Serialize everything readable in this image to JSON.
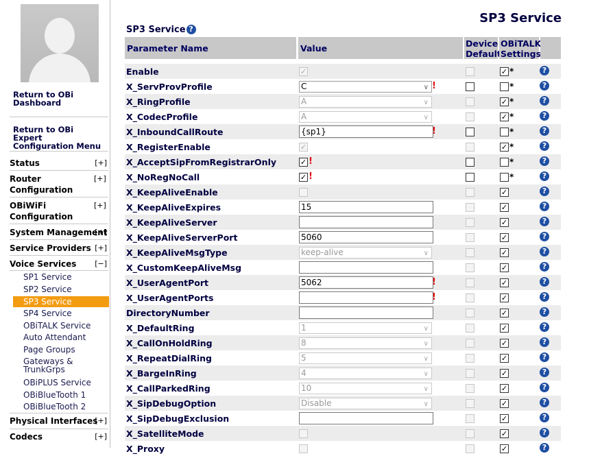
{
  "page": {
    "title": "SP3 Service",
    "section_title": "SP3 Service"
  },
  "sidebar": {
    "links": [
      "Return to OBi Dashboard",
      "Return to OBi Expert Configuration Menu"
    ],
    "menus": [
      {
        "label": "Status",
        "toggle": "[+]"
      },
      {
        "label": "Router Configuration",
        "toggle": "[+]"
      },
      {
        "label": "OBiWiFi Configuration",
        "toggle": "[+]"
      },
      {
        "label": "System Management",
        "toggle": "[+]"
      },
      {
        "label": "Service Providers",
        "toggle": "[+]"
      },
      {
        "label": "Voice Services",
        "toggle": "[−]"
      },
      {
        "label": "Physical Interfaces",
        "toggle": "[+]"
      },
      {
        "label": "Codecs",
        "toggle": "[+]"
      }
    ],
    "voice_items": [
      "SP1 Service",
      "SP2 Service",
      "SP3 Service",
      "SP4 Service",
      "OBiTALK Service",
      "Auto Attendant",
      "Page Groups",
      "Gateways & TrunkGrps",
      "OBiPLUS Service",
      "OBiBlueTooth 1",
      "OBiBlueTooth 2"
    ],
    "selected": "SP3 Service"
  },
  "table": {
    "headers": {
      "name": "Parameter Name",
      "value": "Value",
      "device_default": "Device Default",
      "obitalk": "OBiTALK Settings"
    },
    "rows": [
      {
        "name": "Enable",
        "type": "checkbox",
        "checked": true,
        "disabled": true,
        "dev": false,
        "dev_dis": true,
        "obi": true,
        "star": true
      },
      {
        "name": "X_ServProvProfile",
        "type": "select",
        "value": "C",
        "disabled": false,
        "warn": true,
        "dev": false,
        "dev_dis": false,
        "obi": false,
        "star": true
      },
      {
        "name": "X_RingProfile",
        "type": "select",
        "value": "A",
        "disabled": true,
        "dev": false,
        "dev_dis": true,
        "obi": true,
        "star": true
      },
      {
        "name": "X_CodecProfile",
        "type": "select",
        "value": "A",
        "disabled": true,
        "dev": false,
        "dev_dis": true,
        "obi": true,
        "star": true
      },
      {
        "name": "X_InboundCallRoute",
        "type": "text",
        "value": "{sp1}",
        "warn": true,
        "dev": false,
        "dev_dis": false,
        "obi": false,
        "star": true
      },
      {
        "name": "X_RegisterEnable",
        "type": "checkbox",
        "checked": true,
        "disabled": true,
        "dev": false,
        "dev_dis": true,
        "obi": true,
        "star": true
      },
      {
        "name": "X_AcceptSipFromRegistrarOnly",
        "type": "checkbox",
        "checked": true,
        "disabled": false,
        "warn": true,
        "dev": false,
        "dev_dis": false,
        "obi": false,
        "star": true
      },
      {
        "name": "X_NoRegNoCall",
        "type": "checkbox",
        "checked": true,
        "disabled": false,
        "warn": true,
        "dev": false,
        "dev_dis": false,
        "obi": false,
        "star": true
      },
      {
        "name": "X_KeepAliveEnable",
        "type": "checkbox",
        "checked": false,
        "disabled": true,
        "dev": false,
        "dev_dis": true,
        "obi": true,
        "star": false
      },
      {
        "name": "X_KeepAliveExpires",
        "type": "text",
        "value": "15",
        "dev": false,
        "dev_dis": true,
        "obi": true,
        "star": false
      },
      {
        "name": "X_KeepAliveServer",
        "type": "text",
        "value": "",
        "dev": false,
        "dev_dis": true,
        "obi": true,
        "star": false
      },
      {
        "name": "X_KeepAliveServerPort",
        "type": "text",
        "value": "5060",
        "dev": false,
        "dev_dis": true,
        "obi": true,
        "star": false
      },
      {
        "name": "X_KeepAliveMsgType",
        "type": "select",
        "value": "keep-alive",
        "disabled": true,
        "dev": false,
        "dev_dis": true,
        "obi": true,
        "star": false
      },
      {
        "name": "X_CustomKeepAliveMsg",
        "type": "text",
        "value": "",
        "dev": false,
        "dev_dis": true,
        "obi": true,
        "star": false
      },
      {
        "name": "X_UserAgentPort",
        "type": "text",
        "value": "5062",
        "warn": true,
        "dev": false,
        "dev_dis": true,
        "obi": true,
        "star": false
      },
      {
        "name": "X_UserAgentPorts",
        "type": "text",
        "value": "",
        "warn": true,
        "dev": false,
        "dev_dis": true,
        "obi": true,
        "star": false
      },
      {
        "name": "DirectoryNumber",
        "type": "text",
        "value": "",
        "dev": false,
        "dev_dis": true,
        "obi": true,
        "star": false
      },
      {
        "name": "X_DefaultRing",
        "type": "select",
        "value": "1",
        "disabled": true,
        "dev": false,
        "dev_dis": true,
        "obi": true,
        "star": false
      },
      {
        "name": "X_CallOnHoldRing",
        "type": "select",
        "value": "8",
        "disabled": true,
        "dev": false,
        "dev_dis": true,
        "obi": true,
        "star": false
      },
      {
        "name": "X_RepeatDialRing",
        "type": "select",
        "value": "5",
        "disabled": true,
        "dev": false,
        "dev_dis": true,
        "obi": true,
        "star": false
      },
      {
        "name": "X_BargeInRing",
        "type": "select",
        "value": "4",
        "disabled": true,
        "dev": false,
        "dev_dis": true,
        "obi": true,
        "star": false
      },
      {
        "name": "X_CallParkedRing",
        "type": "select",
        "value": "10",
        "disabled": true,
        "dev": false,
        "dev_dis": true,
        "obi": true,
        "star": false
      },
      {
        "name": "X_SipDebugOption",
        "type": "select",
        "value": "Disable",
        "disabled": true,
        "dev": false,
        "dev_dis": true,
        "obi": true,
        "star": false
      },
      {
        "name": "X_SipDebugExclusion",
        "type": "text",
        "value": "",
        "dev": false,
        "dev_dis": true,
        "obi": true,
        "star": false
      },
      {
        "name": "X_SatelliteMode",
        "type": "checkbox",
        "checked": false,
        "disabled": true,
        "dev": false,
        "dev_dis": true,
        "obi": true,
        "star": false
      },
      {
        "name": "X_Proxy",
        "type": "checkbox",
        "checked": false,
        "disabled": true,
        "dev": false,
        "dev_dis": true,
        "obi": true,
        "star": false
      }
    ]
  },
  "icons": {
    "help": "help-icon",
    "warn": "warning-icon",
    "star": "*"
  }
}
